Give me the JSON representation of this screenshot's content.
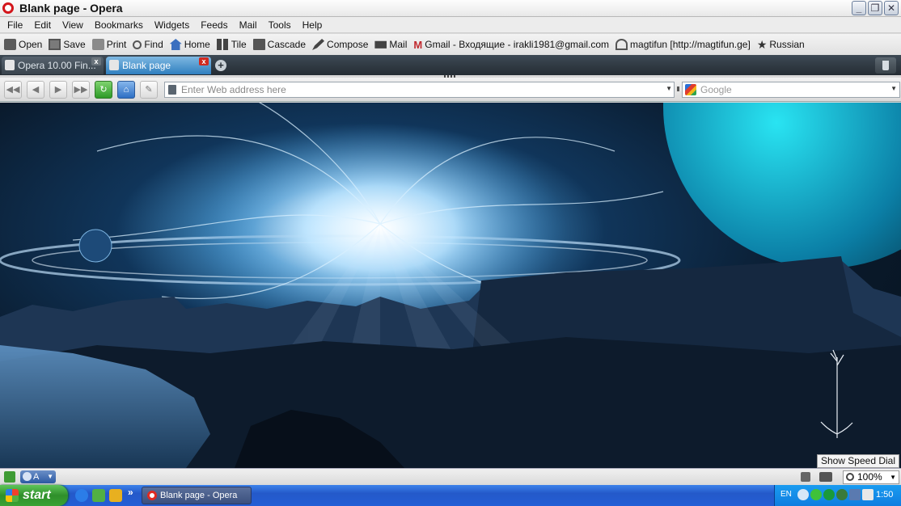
{
  "window": {
    "title": "Blank page - Opera"
  },
  "menu": [
    "File",
    "Edit",
    "View",
    "Bookmarks",
    "Widgets",
    "Feeds",
    "Mail",
    "Tools",
    "Help"
  ],
  "toolbar": {
    "open": "Open",
    "save": "Save",
    "print": "Print",
    "find": "Find",
    "home": "Home",
    "tile": "Tile",
    "cascade": "Cascade",
    "compose": "Compose",
    "mail": "Mail",
    "gmail": "Gmail - Входящие - irakli1981@gmail.com",
    "magtifun": "magtifun [http://magtifun.ge]",
    "russian": "Russian"
  },
  "tabs": [
    {
      "label": "Opera 10.00 Fin...",
      "active": false
    },
    {
      "label": "Blank page",
      "active": true
    }
  ],
  "address": {
    "placeholder": "Enter Web address here",
    "value": ""
  },
  "search": {
    "placeholder": "Google",
    "value": ""
  },
  "tooltip": "Show Speed Dial",
  "statusbar": {
    "turbo_label": "A",
    "zoom": "100%"
  },
  "taskbar": {
    "start_label": "start",
    "task_label": "Blank page - Opera",
    "lang": "EN",
    "clock": "1:50"
  },
  "colors": {
    "accent": "#2f7fbf",
    "opera_red": "#d3151b",
    "taskbar": "#245ed6",
    "start_green": "#3aa334"
  },
  "icons": {
    "toolbar": [
      "folder-icon",
      "save-icon",
      "print-icon",
      "find-icon",
      "home-icon",
      "tile-icon",
      "cascade-icon",
      "compose-icon",
      "mail-icon",
      "gmail-icon",
      "person-icon",
      "star-icon"
    ]
  }
}
